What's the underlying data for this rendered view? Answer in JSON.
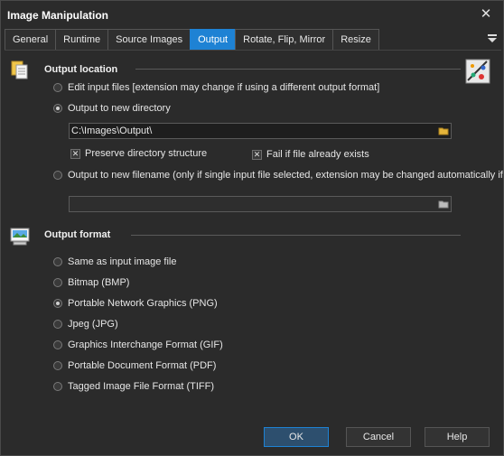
{
  "window": {
    "title": "Image Manipulation"
  },
  "tabs": [
    {
      "label": "General"
    },
    {
      "label": "Runtime"
    },
    {
      "label": "Source Images"
    },
    {
      "label": "Output"
    },
    {
      "label": "Rotate, Flip, Mirror"
    },
    {
      "label": "Resize"
    }
  ],
  "active_tab": "Output",
  "output_location": {
    "heading": "Output location",
    "options": [
      {
        "label": "Edit input files [extension may change if using a different output format]",
        "selected": false
      },
      {
        "label": "Output to new directory",
        "selected": true
      },
      {
        "label": "Output to new filename (only if single input file selected, extension may be changed automatically if",
        "selected": false
      }
    ],
    "directory_value": "C:\\Images\\Output\\",
    "filename_value": "",
    "preserve_label": "Preserve directory structure",
    "preserve_checked": true,
    "fail_label": "Fail if file already exists",
    "fail_checked": true
  },
  "output_format": {
    "heading": "Output format",
    "options": [
      {
        "label": "Same as input image file",
        "selected": false
      },
      {
        "label": "Bitmap (BMP)",
        "selected": false
      },
      {
        "label": "Portable Network Graphics (PNG)",
        "selected": true
      },
      {
        "label": "Jpeg (JPG)",
        "selected": false
      },
      {
        "label": "Graphics Interchange Format (GIF)",
        "selected": false
      },
      {
        "label": "Portable Document Format (PDF)",
        "selected": false
      },
      {
        "label": "Tagged Image File Format (TIFF)",
        "selected": false
      }
    ]
  },
  "buttons": {
    "ok": "OK",
    "cancel": "Cancel",
    "help": "Help"
  },
  "icons": {
    "close": "close-icon",
    "tabs_menu": "hamburger-icon",
    "output_location": "documents-icon",
    "output_format": "image-format-icon",
    "banner": "image-tools-icon",
    "folder": "folder-icon"
  },
  "colors": {
    "accent": "#1e82d4",
    "background": "#2b2b2b"
  }
}
